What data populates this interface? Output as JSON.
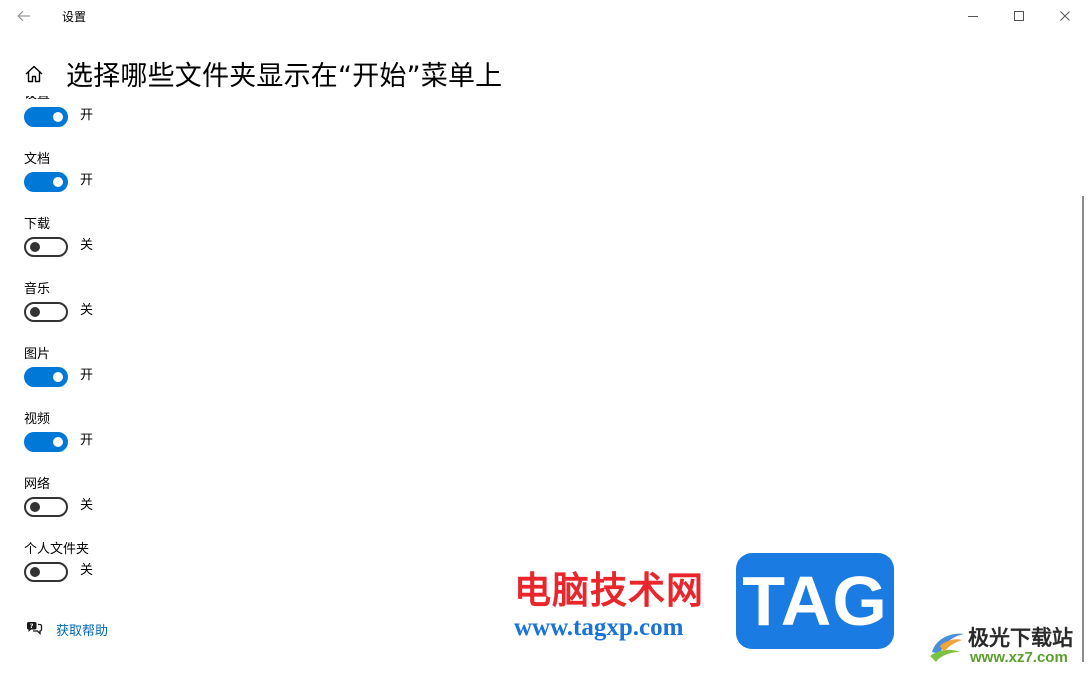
{
  "window": {
    "title": "设置",
    "back_icon": "arrow-left-icon",
    "controls": [
      "minimize-icon",
      "maximize-icon",
      "close-icon"
    ]
  },
  "header": {
    "home_icon": "home-icon",
    "title": "选择哪些文件夹显示在“开始”菜单上"
  },
  "settings": [
    {
      "label": "设置",
      "state": "开",
      "on": true
    },
    {
      "label": "文档",
      "state": "开",
      "on": true
    },
    {
      "label": "下载",
      "state": "关",
      "on": false
    },
    {
      "label": "音乐",
      "state": "关",
      "on": false
    },
    {
      "label": "图片",
      "state": "开",
      "on": true
    },
    {
      "label": "视频",
      "state": "开",
      "on": true
    },
    {
      "label": "网络",
      "state": "关",
      "on": false
    },
    {
      "label": "个人文件夹",
      "state": "关",
      "on": false
    }
  ],
  "help": {
    "icon": "help-chat-icon",
    "label": "获取帮助"
  },
  "watermark": {
    "site_name": "电脑技术网",
    "site_url": "www.tagxp.com",
    "tag": "TAG",
    "brand_name": "极光下载站",
    "brand_url": "www.xz7.com"
  },
  "colors": {
    "accent": "#0078d7",
    "link": "#0067b8",
    "toggle_off_border": "#333333",
    "watermark_red": "#e8262b",
    "watermark_blue": "#1a7be3"
  }
}
